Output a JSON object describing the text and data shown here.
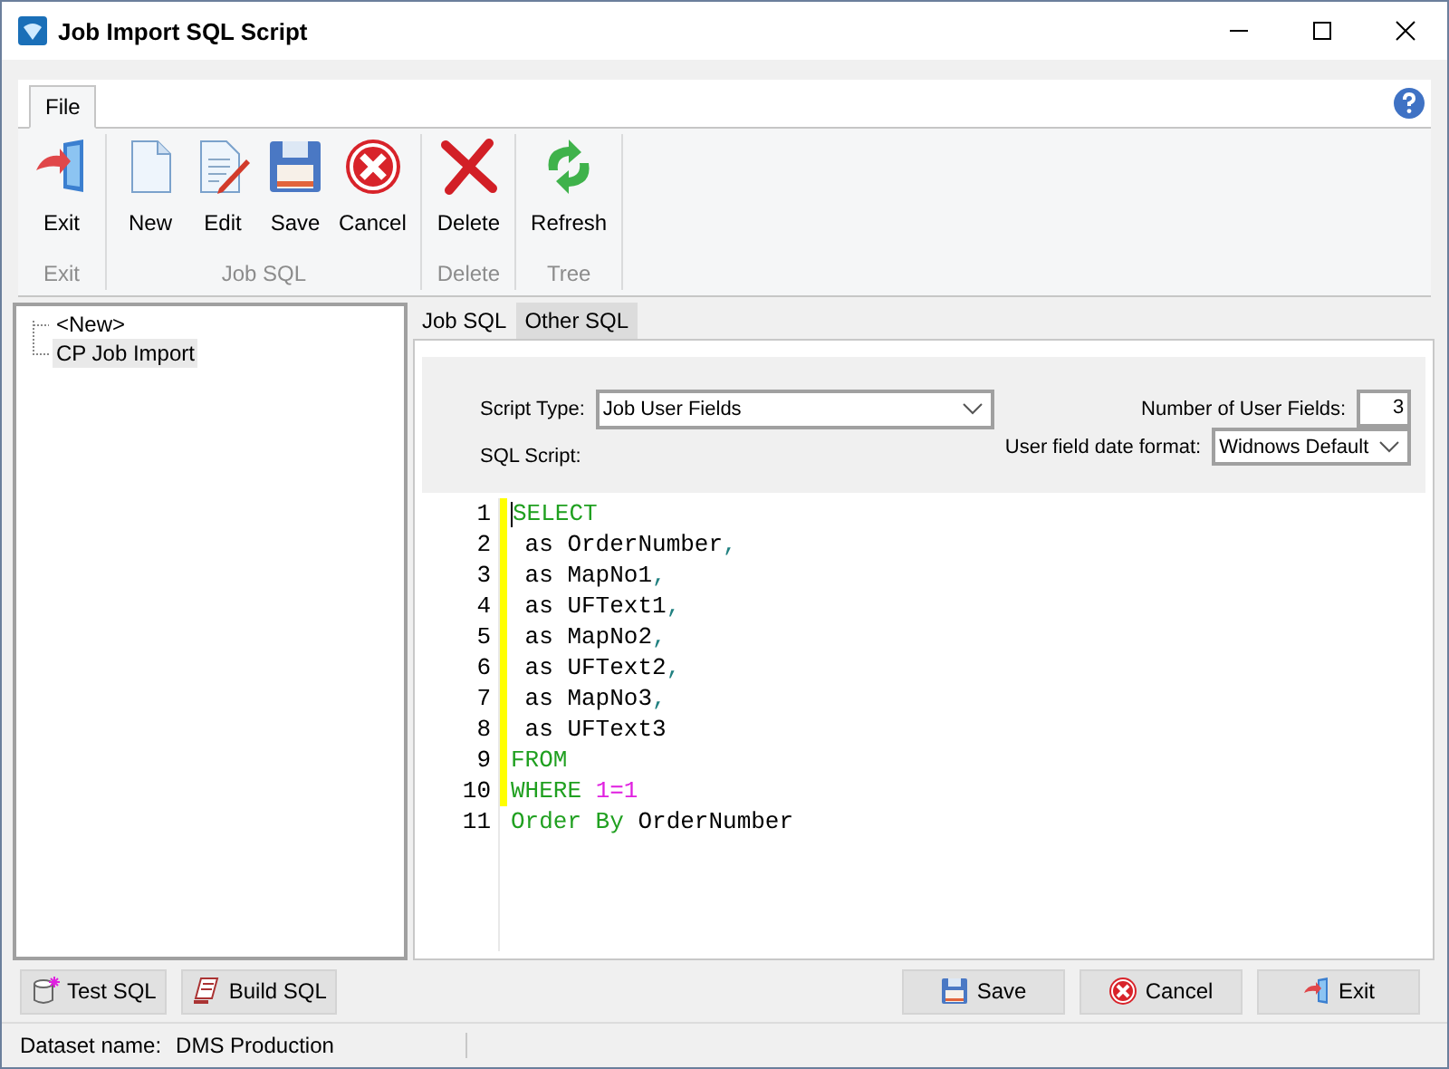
{
  "window": {
    "title": "Job Import SQL Script"
  },
  "ribbon": {
    "tabs": [
      {
        "label": "File",
        "selected": true
      }
    ],
    "groups": [
      {
        "label": "Exit",
        "buttons": [
          {
            "label": "Exit",
            "kind": "exit"
          }
        ]
      },
      {
        "label": "Job SQL",
        "buttons": [
          {
            "label": "New",
            "kind": "new"
          },
          {
            "label": "Edit",
            "kind": "edit"
          },
          {
            "label": "Save",
            "kind": "save"
          },
          {
            "label": "Cancel",
            "kind": "cancel"
          }
        ]
      },
      {
        "label": "Delete",
        "buttons": [
          {
            "label": "Delete",
            "kind": "delete"
          }
        ]
      },
      {
        "label": "Tree",
        "buttons": [
          {
            "label": "Refresh",
            "kind": "refresh"
          }
        ]
      }
    ]
  },
  "tree": {
    "items": [
      {
        "label": "<New>",
        "selected": false
      },
      {
        "label": "CP Job Import",
        "selected": true
      }
    ]
  },
  "editor_tabs": [
    {
      "label": "Job SQL",
      "selected": false
    },
    {
      "label": "Other SQL",
      "selected": true
    }
  ],
  "settings": {
    "script_type_label": "Script Type:",
    "script_type": "Job User Fields",
    "sql_script_label": "SQL Script:",
    "user_fields_label": "Number of User Fields:",
    "user_fields": "3",
    "date_format_label": "User field date format:",
    "date_format": "Widnows Default"
  },
  "code_lines": [
    {
      "number": "1",
      "changed": true,
      "tokens": [
        {
          "kind": "keyword",
          "text": "SELECT"
        }
      ]
    },
    {
      "number": "2",
      "changed": true,
      "tokens": [
        {
          "kind": "plain",
          "text": " as OrderNumber"
        },
        {
          "kind": "punct",
          "text": ","
        }
      ]
    },
    {
      "number": "3",
      "changed": true,
      "tokens": [
        {
          "kind": "plain",
          "text": " as MapNo1"
        },
        {
          "kind": "punct",
          "text": ","
        }
      ]
    },
    {
      "number": "4",
      "changed": true,
      "tokens": [
        {
          "kind": "plain",
          "text": " as UFText1"
        },
        {
          "kind": "punct",
          "text": ","
        }
      ]
    },
    {
      "number": "5",
      "changed": true,
      "tokens": [
        {
          "kind": "plain",
          "text": " as MapNo2"
        },
        {
          "kind": "punct",
          "text": ","
        }
      ]
    },
    {
      "number": "6",
      "changed": true,
      "tokens": [
        {
          "kind": "plain",
          "text": " as UFText2"
        },
        {
          "kind": "punct",
          "text": ","
        }
      ]
    },
    {
      "number": "7",
      "changed": true,
      "tokens": [
        {
          "kind": "plain",
          "text": " as MapNo3"
        },
        {
          "kind": "punct",
          "text": ","
        }
      ]
    },
    {
      "number": "8",
      "changed": true,
      "tokens": [
        {
          "kind": "plain",
          "text": " as UFText3"
        }
      ]
    },
    {
      "number": "9",
      "changed": true,
      "tokens": [
        {
          "kind": "keyword",
          "text": "FROM"
        }
      ]
    },
    {
      "number": "10",
      "changed": true,
      "tokens": [
        {
          "kind": "keyword",
          "text": "WHERE "
        },
        {
          "kind": "number",
          "text": "1=1"
        }
      ]
    },
    {
      "number": "11",
      "changed": false,
      "tokens": [
        {
          "kind": "keyword",
          "text": "Order By"
        },
        {
          "kind": "plain",
          "text": " OrderNumber"
        }
      ]
    }
  ],
  "left_buttons": [
    {
      "label": "Test SQL",
      "kind": "test"
    },
    {
      "label": "Build SQL",
      "kind": "build"
    }
  ],
  "right_buttons": [
    {
      "label": "Save",
      "kind": "save"
    },
    {
      "label": "Cancel",
      "kind": "cancel"
    },
    {
      "label": "Exit",
      "kind": "exit"
    }
  ],
  "status_bar": {
    "label": "Dataset name:",
    "value": "DMS Production"
  }
}
